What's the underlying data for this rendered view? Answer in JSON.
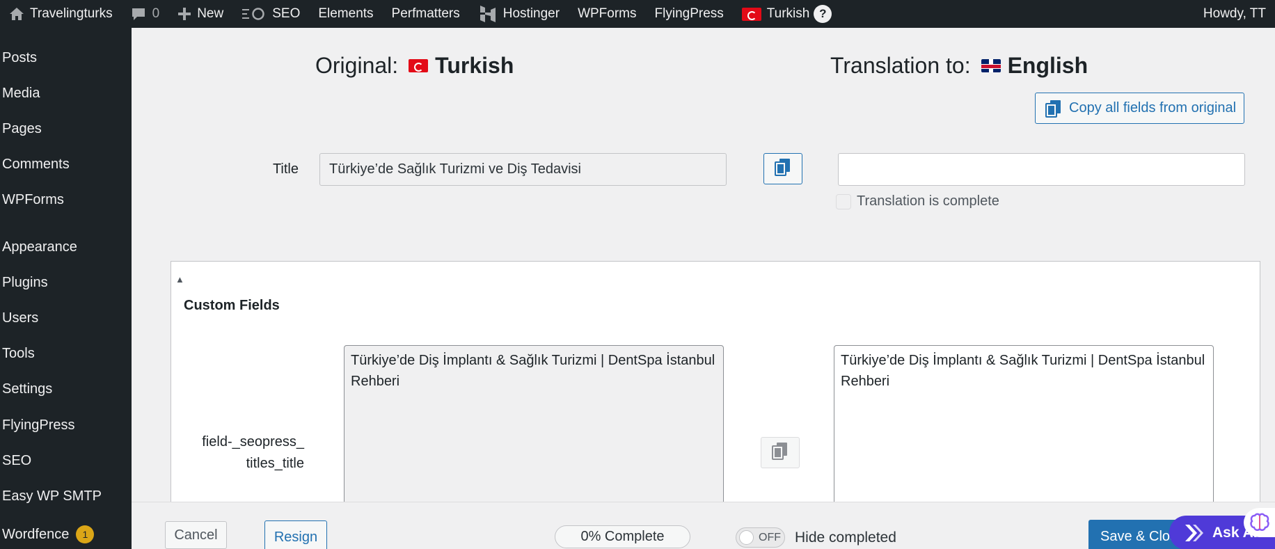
{
  "adminbar": {
    "site_name": "Travelingturks",
    "comments_count": "0",
    "new_label": "New",
    "seo_label": "SEO",
    "elements_label": "Elements",
    "perfmatters_label": "Perfmatters",
    "hostinger_label": "Hostinger",
    "wpforms_label": "WPForms",
    "flyingpress_label": "FlyingPress",
    "language_label": "Turkish",
    "help_glyph": "?",
    "greeting": "Howdy, TT"
  },
  "sidebar": {
    "items": [
      {
        "label": "Posts"
      },
      {
        "label": "Media"
      },
      {
        "label": "Pages"
      },
      {
        "label": "Comments"
      },
      {
        "label": "WPForms"
      },
      {
        "label": "Appearance"
      },
      {
        "label": "Plugins"
      },
      {
        "label": "Users"
      },
      {
        "label": "Tools"
      },
      {
        "label": "Settings"
      },
      {
        "label": "FlyingPress"
      },
      {
        "label": "SEO"
      },
      {
        "label": "Easy WP SMTP"
      },
      {
        "label": "Wordfence",
        "badge": "1"
      }
    ]
  },
  "editor": {
    "original_prefix": "Original:",
    "original_language": "Turkish",
    "translation_prefix": "Translation to:",
    "translation_language": "English",
    "copy_all_label": "Copy all fields from original",
    "title_label": "Title",
    "title_original_value": "Türkiye’de Sağlık Turizmi ve Diş Tedavisi",
    "title_translation_value": "",
    "translation_complete_label": "Translation is complete",
    "translation_complete_checked": false,
    "custom_fields": {
      "toggle_glyph": "▲",
      "title": "Custom Fields",
      "field_label_line1": "field-_seopress_",
      "field_label_line2": "titles_title",
      "original_value": "Türkiye’de Diş İmplantı & Sağlık Turizmi | DentSpa İstanbul Rehberi",
      "translation_value": "Türkiye’de Diş İmplantı & Sağlık Turizmi | DentSpa İstanbul Rehberi"
    }
  },
  "footer": {
    "cancel_label": "Cancel",
    "resign_label": "Resign",
    "progress_text": "0% Complete",
    "progress_value": 0,
    "toggle_state": "OFF",
    "hide_completed_label": "Hide completed",
    "save_label": "Save & Close",
    "ask_ai_label": "Ask AI"
  },
  "colors": {
    "adminbar_bg": "#1d2327",
    "accent_blue": "#2271b1",
    "ask_ai_purple": "#4f3ad8",
    "badge_orange": "#dba617"
  },
  "icons": [
    "home-icon",
    "comment-icon",
    "plus-icon",
    "seo-icon",
    "hostinger-icon",
    "flag-tr-icon",
    "help-icon",
    "flag-uk-icon",
    "copy-icon",
    "ask-ai-icon",
    "brain-icon"
  ]
}
